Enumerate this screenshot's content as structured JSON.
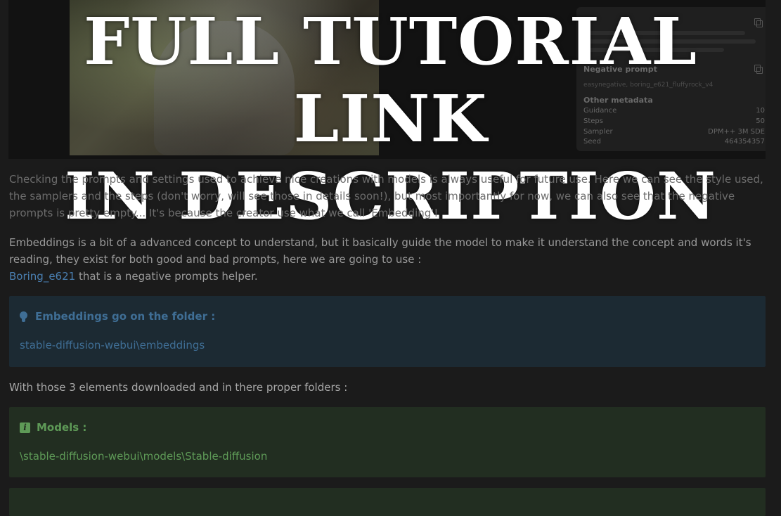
{
  "overlay": {
    "line1": "FULL TUTORIAL LINK",
    "line2": "IN DESCRIPTION"
  },
  "gen_panel": {
    "negative_prompt_label": "Negative prompt",
    "negative_prompt_value": "easynegative, boring_e621_fluffyrock_v4",
    "other_metadata_label": "Other metadata",
    "settings": [
      {
        "key": "Guidance",
        "value": "10"
      },
      {
        "key": "Steps",
        "value": "50"
      },
      {
        "key": "Sampler",
        "value": "DPM++ 3M SDE"
      },
      {
        "key": "Seed",
        "value": "464354357"
      }
    ]
  },
  "article": {
    "para1": "Checking the prompts and settings used to achieve nice creations with models is always useful for future use. Here we can see the style used, the samplers and the steps (don't worry, will see those in details soon!), but most importantly for now, we can also see that the negative prompts is pretty empty... It's because the creator use what we call 'Embedding'!",
    "para2_text": "Embeddings is a bit of a advanced concept to understand, but it basically guide the model to make it understand the concept and words it's reading, they exist for both good and bad prompts, here we are going to use :",
    "para2_link": "Boring_e621",
    "para2_suffix": " that is a negative prompts helper.",
    "tip_callout": {
      "icon": "lightbulb-icon",
      "title": "Embeddings go on the folder :",
      "body": "stable-diffusion-webui\\embeddings",
      "color": "#3f6e95"
    },
    "downloaded_line": "With those 3 elements downloaded and in there proper folders :",
    "models_callout": {
      "icon": "info-icon",
      "title": "Models :",
      "body": "\\stable-diffusion-webui\\models\\Stable-diffusion",
      "color": "#5e9a57"
    }
  }
}
